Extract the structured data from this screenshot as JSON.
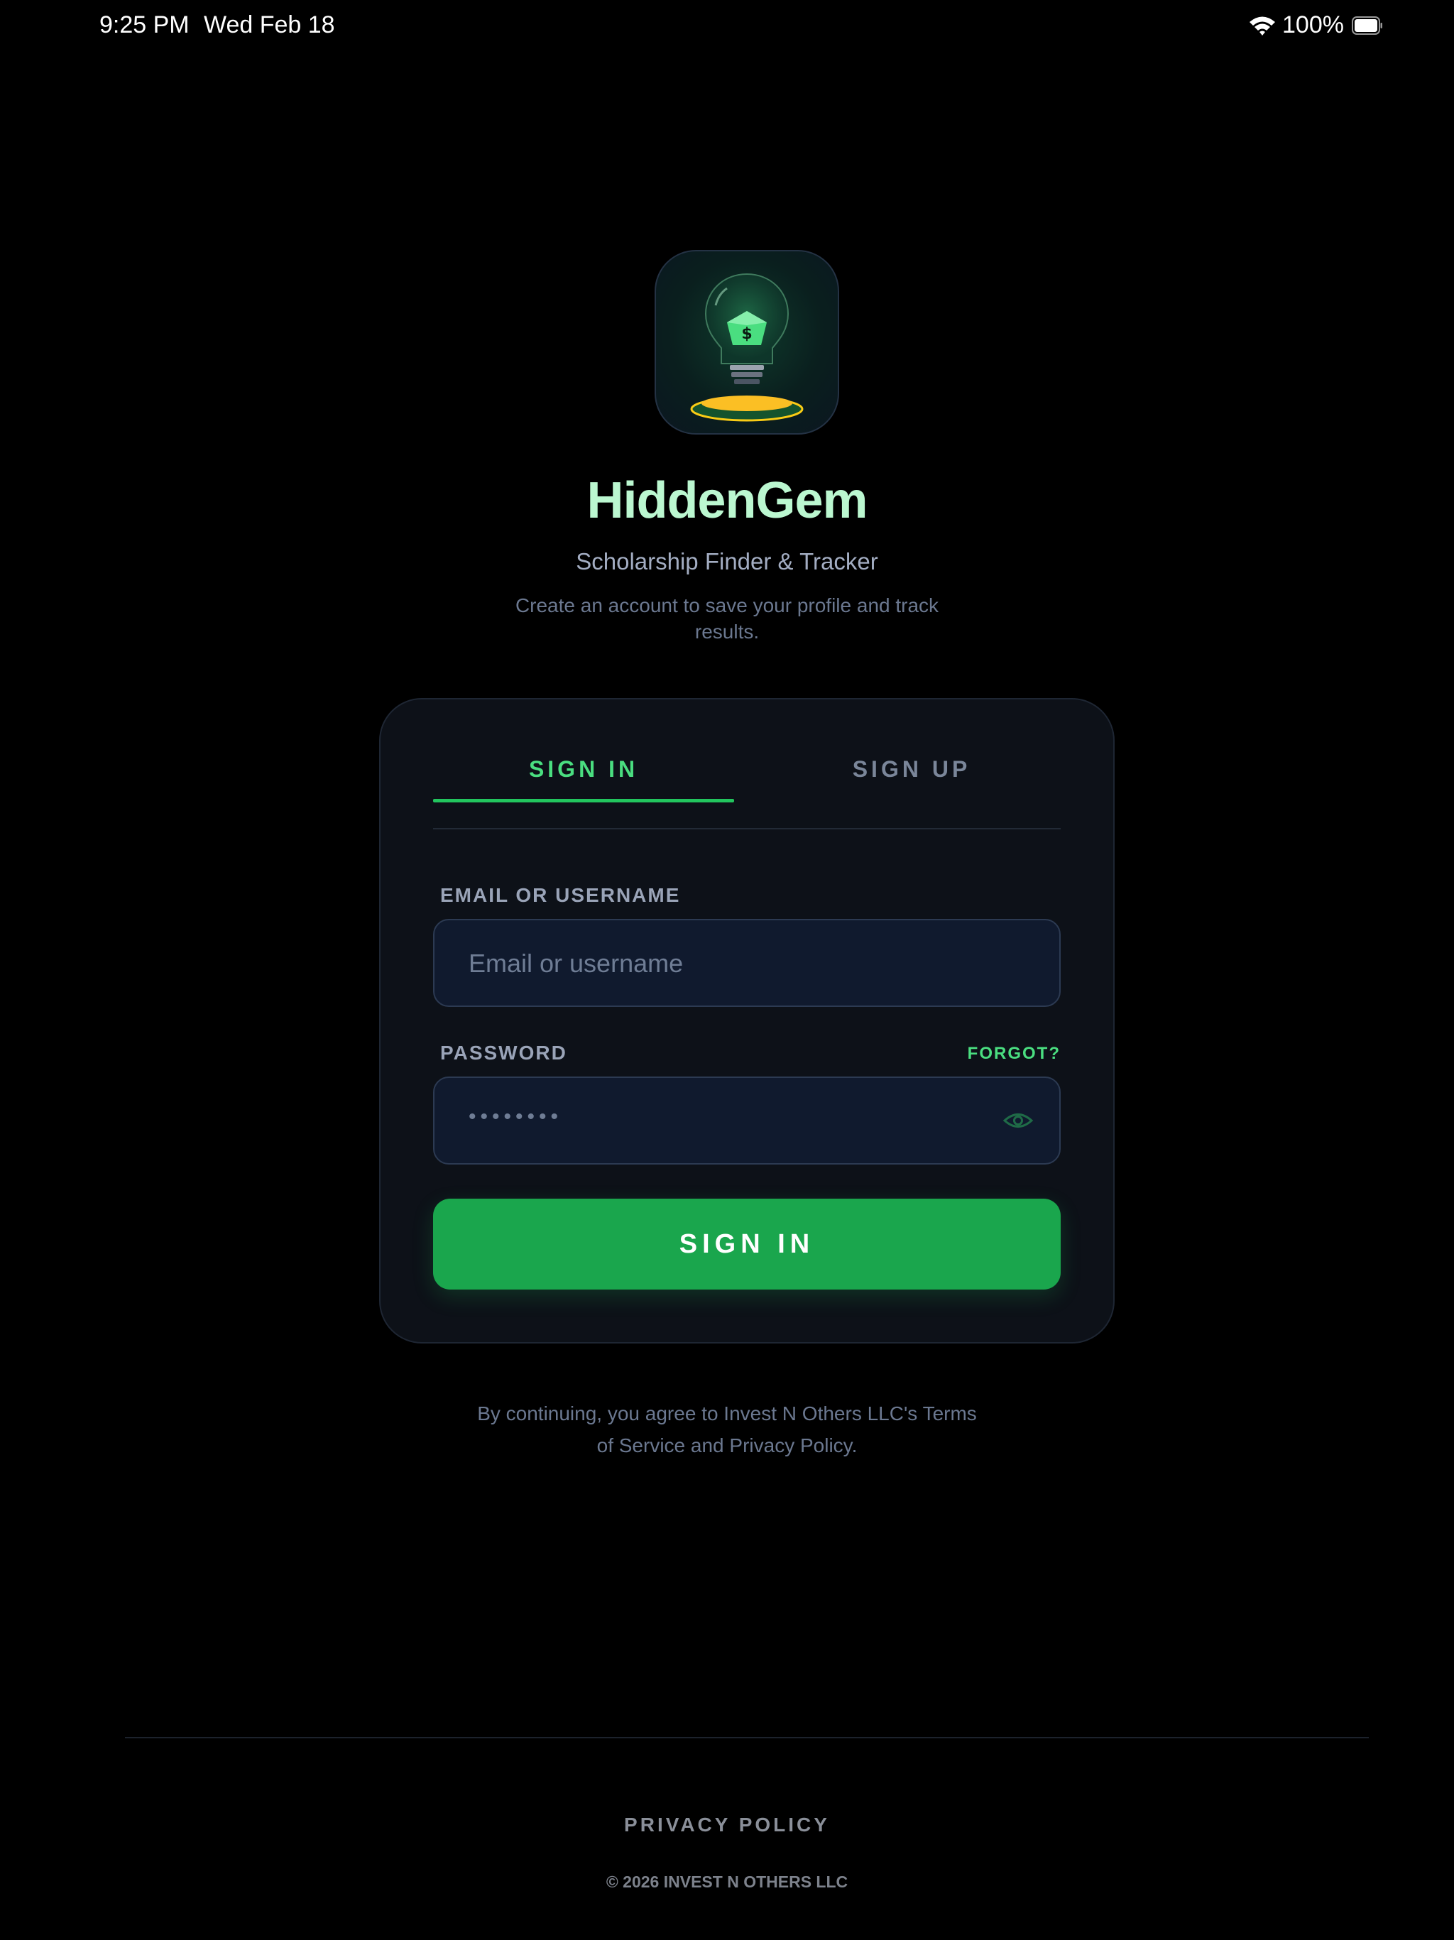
{
  "status_bar": {
    "time": "9:25 PM",
    "date": "Wed Feb 18",
    "battery_percent": "100%",
    "wifi_icon": "wifi-icon",
    "battery_icon": "battery-icon"
  },
  "branding": {
    "logo_icon": "lightbulb-gem-icon",
    "app_name": "HiddenGem",
    "subtitle": "Scholarship Finder & Tracker",
    "tagline": "Create an account to save your profile and track results."
  },
  "auth": {
    "tabs": [
      {
        "label": "SIGN IN",
        "active": true
      },
      {
        "label": "SIGN UP",
        "active": false
      }
    ],
    "email_label": "EMAIL OR USERNAME",
    "email_placeholder": "Email or username",
    "email_value": "",
    "password_label": "PASSWORD",
    "forgot_label": "FORGOT?",
    "password_masked": "••••••••",
    "show_password_icon": "eye-icon",
    "submit_label": "SIGN IN"
  },
  "legal": {
    "text": "By continuing, you agree to Invest N Others LLC's Terms of Service and Privacy Policy."
  },
  "footer": {
    "privacy_link": "PRIVACY POLICY",
    "copyright": "© 2026 INVEST N OTHERS LLC"
  },
  "colors": {
    "background": "#000000",
    "accent": "#22c55e",
    "button": "#1aa64d",
    "title": "#bbf7d0",
    "card": "#0d1118",
    "input": "#101a2e"
  }
}
